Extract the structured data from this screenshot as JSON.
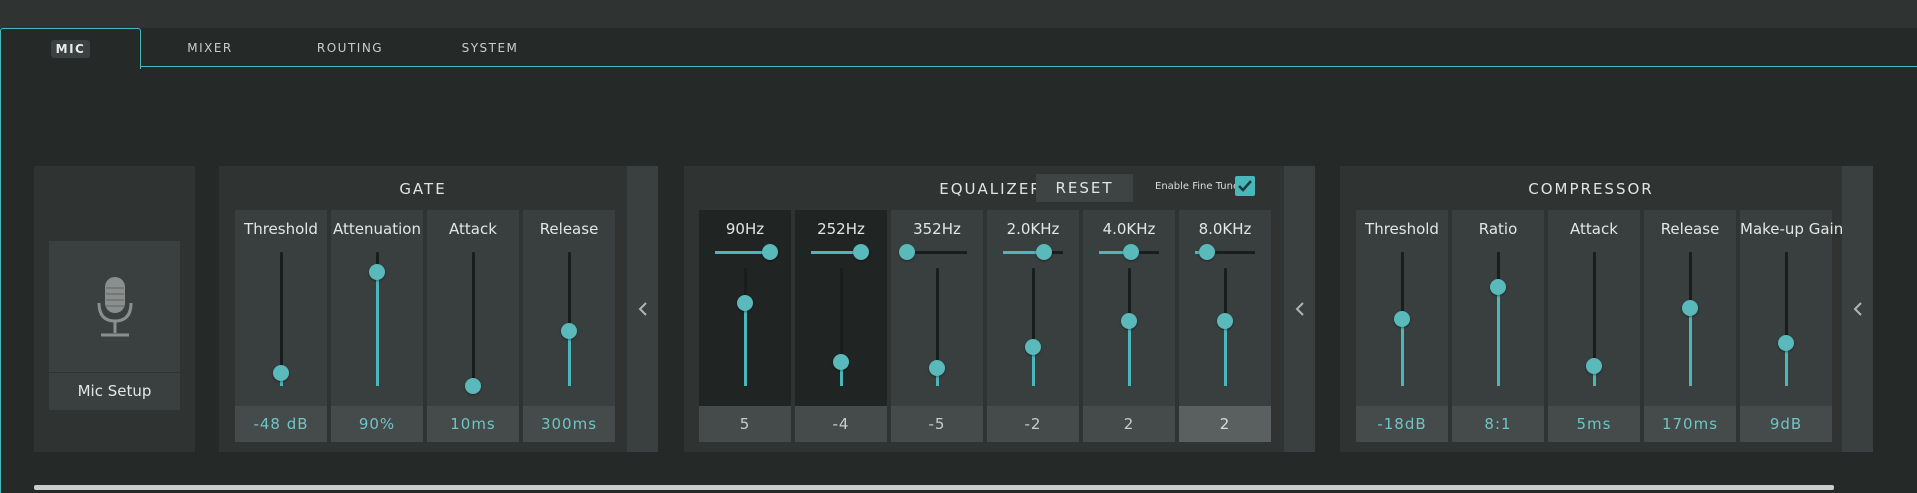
{
  "tabs": [
    {
      "label": "MIC",
      "active": true
    },
    {
      "label": "MIXER"
    },
    {
      "label": "ROUTING"
    },
    {
      "label": "SYSTEM"
    }
  ],
  "mic": {
    "label": "Mic Setup",
    "icon": "microphone-icon"
  },
  "gate": {
    "title": "GATE",
    "controls": [
      {
        "label": "Threshold",
        "value": "-48 dB",
        "level": 0.1
      },
      {
        "label": "Attenuation",
        "value": "90%",
        "level": 0.85
      },
      {
        "label": "Attack",
        "value": "10ms",
        "level": 0.0
      },
      {
        "label": "Release",
        "value": "300ms",
        "level": 0.41
      }
    ]
  },
  "equalizer": {
    "title": "EQUALIZER",
    "reset_label": "RESET",
    "fine_tune_label": "Enable Fine Tune",
    "fine_tune_checked": true,
    "bands": [
      {
        "label": "90Hz",
        "value": "5",
        "gain_level": 0.7,
        "freq_level": 0.92
      },
      {
        "label": "252Hz",
        "value": "-4",
        "gain_level": 0.2,
        "freq_level": 0.83
      },
      {
        "label": "352Hz",
        "value": "-5",
        "gain_level": 0.15,
        "freq_level": 0.0
      },
      {
        "label": "2.0KHz",
        "value": "-2",
        "gain_level": 0.33,
        "freq_level": 0.68
      },
      {
        "label": "4.0KHz",
        "value": "2",
        "gain_level": 0.55,
        "freq_level": 0.53
      },
      {
        "label": "8.0KHz",
        "value": "2",
        "gain_level": 0.55,
        "freq_level": 0.2,
        "selected": true
      }
    ]
  },
  "compressor": {
    "title": "COMPRESSOR",
    "controls": [
      {
        "label": "Threshold",
        "value": "-18dB",
        "level": 0.5
      },
      {
        "label": "Ratio",
        "value": "8:1",
        "level": 0.74
      },
      {
        "label": "Attack",
        "value": "5ms",
        "level": 0.15
      },
      {
        "label": "Release",
        "value": "170ms",
        "level": 0.58
      },
      {
        "label": "Make-up Gain",
        "value": "9dB",
        "level": 0.32
      }
    ]
  },
  "colors": {
    "accent": "#4ab8bb",
    "panel": "#2f3433",
    "background": "#252a29"
  },
  "icons": {
    "collapse": "chevron-left-icon",
    "check": "check-icon"
  }
}
